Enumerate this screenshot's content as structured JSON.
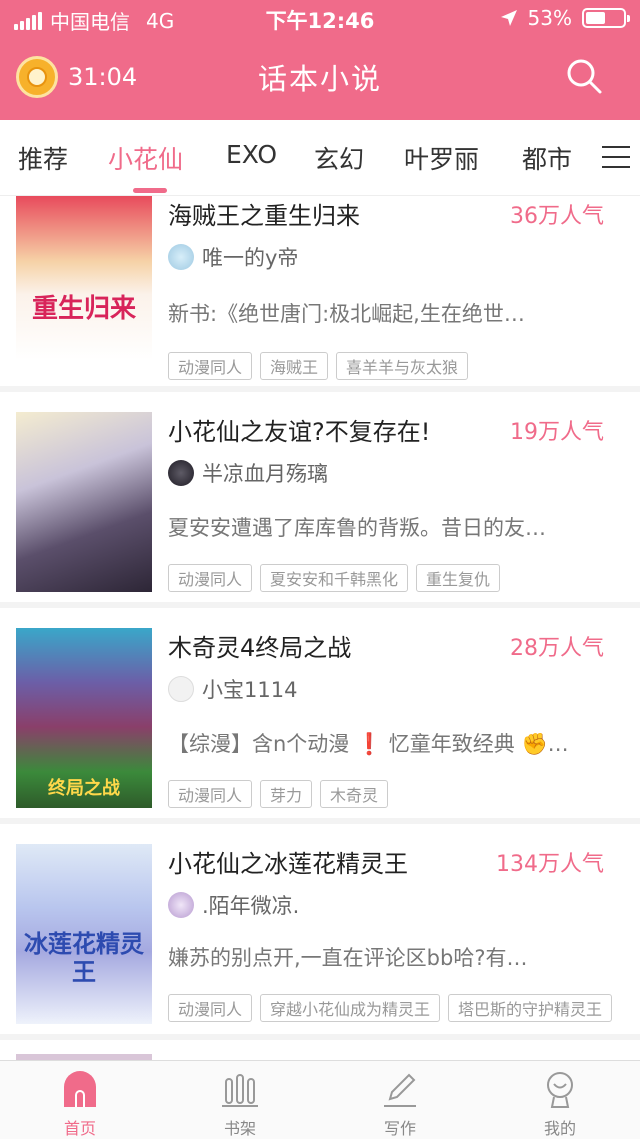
{
  "status_bar": {
    "carrier": "中国电信",
    "network": "4G",
    "time": "下午12:46",
    "battery": "53%",
    "battery_level": 0.53
  },
  "header": {
    "timer": "31:04",
    "title": "话本小说",
    "icons": [
      "alarm-icon",
      "search-icon"
    ]
  },
  "tabs": [
    "推荐",
    "小花仙",
    "EXO",
    "玄幻",
    "叶罗丽",
    "都市"
  ],
  "active_tab": "小花仙",
  "books": [
    {
      "title": "海贼王之重生归来",
      "popularity": "36万人气",
      "author": "唯一的y帝",
      "desc": "新书:《绝世唐门:极北崛起,生在绝世…",
      "tags": [
        "动漫同人",
        "海贼王",
        "喜羊羊与灰太狼"
      ],
      "cover_text": "重生归来"
    },
    {
      "title": "小花仙之友谊?不复存在!",
      "popularity": "19万人气",
      "author": "半凉血月殇璃",
      "desc": "夏安安遭遇了库库鲁的背叛。昔日的友…",
      "tags": [
        "动漫同人",
        "夏安安和千韩黑化",
        "重生复仇"
      ],
      "cover_text": ""
    },
    {
      "title": "木奇灵4终局之战",
      "popularity": "28万人气",
      "author": "小宝1114",
      "desc": "【综漫】含n个动漫 ❗ 忆童年致经典 ✊…",
      "tags": [
        "动漫同人",
        "芽力",
        "木奇灵"
      ],
      "cover_text": "终局之战"
    },
    {
      "title": "小花仙之冰莲花精灵王",
      "popularity": "134万人气",
      "author": ".陌年微凉.",
      "desc": "嫌苏的别点开,一直在评论区bb哈?有…",
      "tags": [
        "动漫同人",
        "穿越小花仙成为精灵王",
        "塔巴斯的守护精灵王"
      ],
      "cover_text": "冰莲花精灵王"
    }
  ],
  "bottom_nav": [
    {
      "label": "首页",
      "icon": "home-icon"
    },
    {
      "label": "书架",
      "icon": "bookshelf-icon"
    },
    {
      "label": "写作",
      "icon": "pen-icon"
    },
    {
      "label": "我的",
      "icon": "profile-icon"
    }
  ],
  "colors": {
    "brand": "#f06b8a",
    "text": "#333333",
    "muted": "#999999"
  }
}
